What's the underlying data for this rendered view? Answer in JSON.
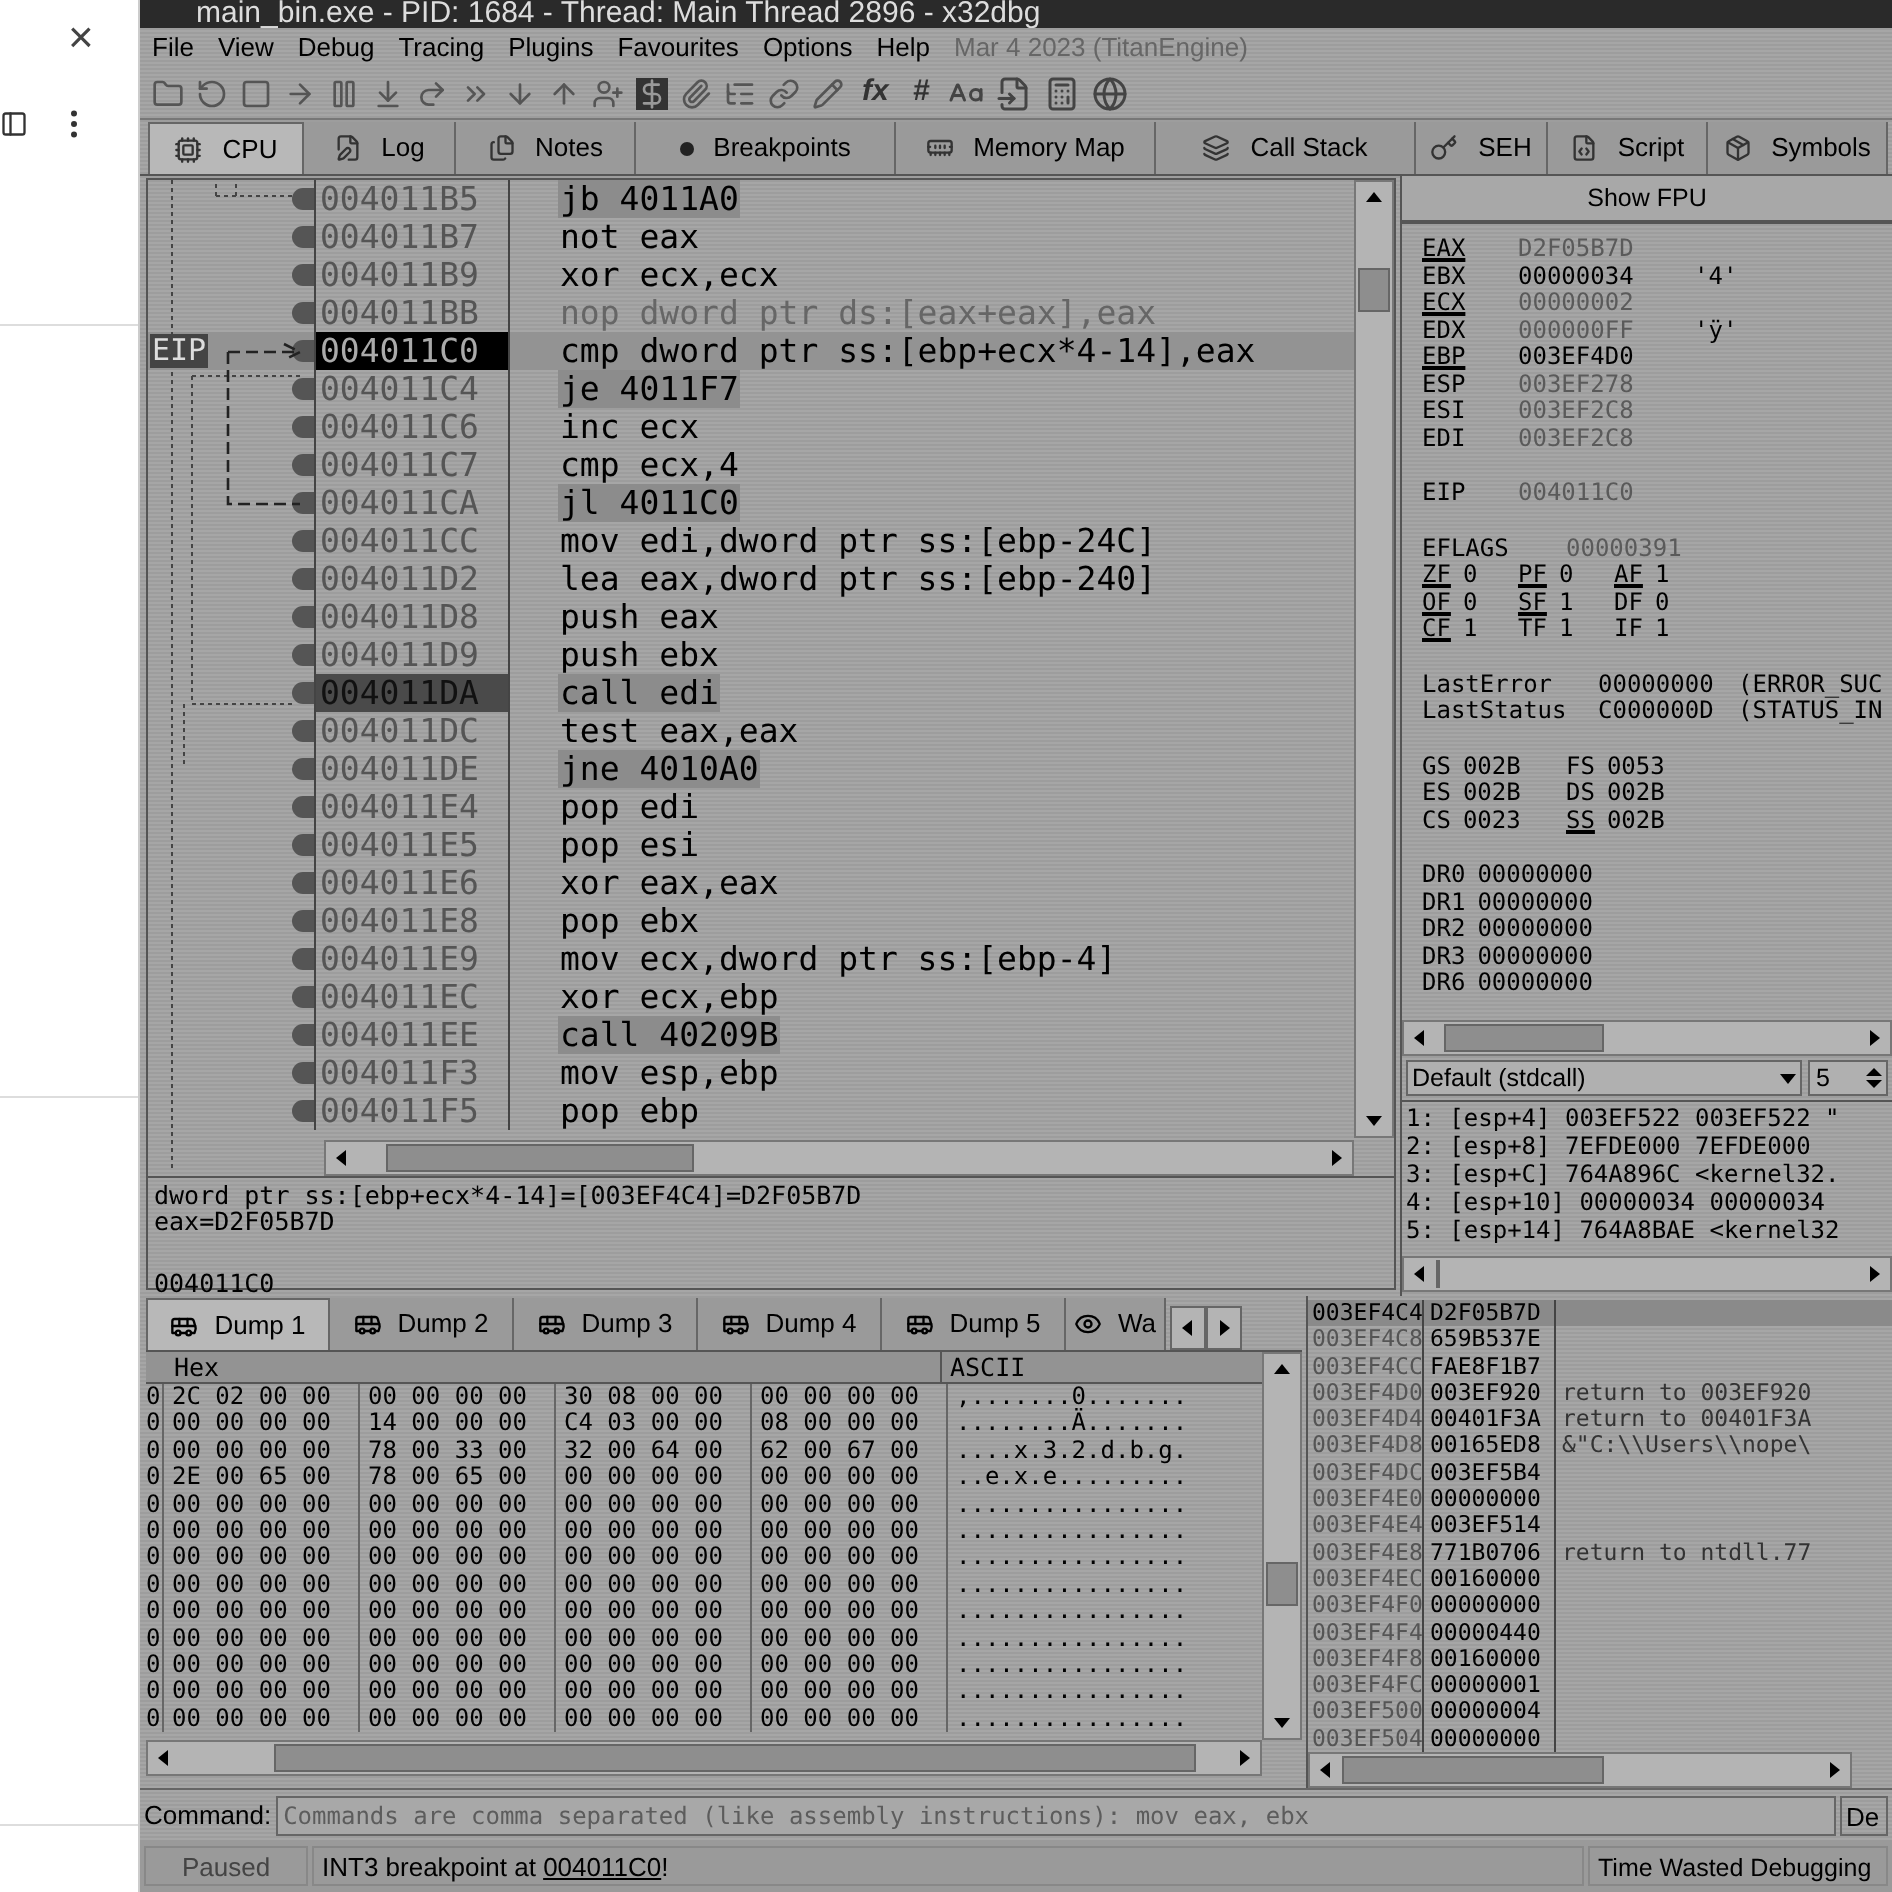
{
  "browser": {
    "close_glyph": "×"
  },
  "window": {
    "title": "main_bin.exe - PID: 1684 - Thread: Main Thread 2896 - x32dbg"
  },
  "menu": [
    "File",
    "View",
    "Debug",
    "Tracing",
    "Plugins",
    "Favourites",
    "Options",
    "Help"
  ],
  "build_info": "Mar 4 2023 (TitanEngine)",
  "toolbar_glyphs": [
    "fx",
    "#"
  ],
  "tabs": [
    {
      "label": "CPU",
      "selected": true
    },
    {
      "label": "Log",
      "selected": false
    },
    {
      "label": "Notes",
      "selected": false
    },
    {
      "label": "Breakpoints",
      "selected": false
    },
    {
      "label": "Memory Map",
      "selected": false
    },
    {
      "label": "Call Stack",
      "selected": false
    },
    {
      "label": "SEH",
      "selected": false
    },
    {
      "label": "Script",
      "selected": false
    },
    {
      "label": "Symbols",
      "selected": false
    }
  ],
  "eip_label": "EIP",
  "disassembly": [
    {
      "address": "004011B5",
      "instruction": "jb 4011A0",
      "kind": "branch",
      "eip": false,
      "selected": false
    },
    {
      "address": "004011B7",
      "instruction": "not eax",
      "kind": "normal",
      "eip": false,
      "selected": false
    },
    {
      "address": "004011B9",
      "instruction": "xor ecx,ecx",
      "kind": "normal",
      "eip": false,
      "selected": false
    },
    {
      "address": "004011BB",
      "instruction": "nop dword ptr ds:[eax+eax],eax",
      "kind": "nop",
      "eip": false,
      "selected": false
    },
    {
      "address": "004011C0",
      "instruction": "cmp dword ptr ss:[ebp+ecx*4-14],eax",
      "kind": "normal",
      "eip": true,
      "selected": false
    },
    {
      "address": "004011C4",
      "instruction": "je 4011F7",
      "kind": "branch",
      "eip": false,
      "selected": false
    },
    {
      "address": "004011C6",
      "instruction": "inc ecx",
      "kind": "normal",
      "eip": false,
      "selected": false
    },
    {
      "address": "004011C7",
      "instruction": "cmp ecx,4",
      "kind": "normal",
      "eip": false,
      "selected": false
    },
    {
      "address": "004011CA",
      "instruction": "jl 4011C0",
      "kind": "branch",
      "eip": false,
      "selected": false
    },
    {
      "address": "004011CC",
      "instruction": "mov edi,dword ptr ss:[ebp-24C]",
      "kind": "normal",
      "eip": false,
      "selected": false
    },
    {
      "address": "004011D2",
      "instruction": "lea eax,dword ptr ss:[ebp-240]",
      "kind": "normal",
      "eip": false,
      "selected": false
    },
    {
      "address": "004011D8",
      "instruction": "push eax",
      "kind": "normal",
      "eip": false,
      "selected": false
    },
    {
      "address": "004011D9",
      "instruction": "push ebx",
      "kind": "normal",
      "eip": false,
      "selected": false
    },
    {
      "address": "004011DA",
      "instruction": "call edi",
      "kind": "call",
      "eip": false,
      "selected": true
    },
    {
      "address": "004011DC",
      "instruction": "test eax,eax",
      "kind": "normal",
      "eip": false,
      "selected": false
    },
    {
      "address": "004011DE",
      "instruction": "jne 4010A0",
      "kind": "branch",
      "eip": false,
      "selected": false
    },
    {
      "address": "004011E4",
      "instruction": "pop edi",
      "kind": "normal",
      "eip": false,
      "selected": false
    },
    {
      "address": "004011E5",
      "instruction": "pop esi",
      "kind": "normal",
      "eip": false,
      "selected": false
    },
    {
      "address": "004011E6",
      "instruction": "xor eax,eax",
      "kind": "normal",
      "eip": false,
      "selected": false
    },
    {
      "address": "004011E8",
      "instruction": "pop ebx",
      "kind": "normal",
      "eip": false,
      "selected": false
    },
    {
      "address": "004011E9",
      "instruction": "mov ecx,dword ptr ss:[ebp-4]",
      "kind": "normal",
      "eip": false,
      "selected": false
    },
    {
      "address": "004011EC",
      "instruction": "xor ecx,ebp",
      "kind": "normal",
      "eip": false,
      "selected": false
    },
    {
      "address": "004011EE",
      "instruction": "call 40209B",
      "kind": "call",
      "eip": false,
      "selected": false
    },
    {
      "address": "004011F3",
      "instruction": "mov esp,ebp",
      "kind": "normal",
      "eip": false,
      "selected": false
    },
    {
      "address": "004011F5",
      "instruction": "pop ebp",
      "kind": "normal",
      "eip": false,
      "selected": false
    }
  ],
  "info_lines": [
    "dword ptr ss:[ebp+ecx*4-14]=[003EF4C4]=D2F05B7D",
    "eax=D2F05B7D"
  ],
  "info_address": "004011C0",
  "fpu_button": "Show FPU",
  "registers": [
    {
      "name": "EAX",
      "value": "D2F05B7D",
      "underlined": true,
      "changed": false
    },
    {
      "name": "EBX",
      "value": "00000034",
      "comment": "'4'",
      "underlined": false,
      "changed": true
    },
    {
      "name": "ECX",
      "value": "00000002",
      "underlined": true,
      "changed": false
    },
    {
      "name": "EDX",
      "value": "000000FF",
      "comment": "'ÿ'",
      "underlined": false,
      "changed": false
    },
    {
      "name": "EBP",
      "value": "003EF4D0",
      "underlined": true,
      "changed": true
    },
    {
      "name": "ESP",
      "value": "003EF278",
      "underlined": false,
      "changed": false
    },
    {
      "name": "ESI",
      "value": "003EF2C8",
      "underlined": false,
      "changed": false
    },
    {
      "name": "EDI",
      "value": "003EF2C8",
      "underlined": false,
      "changed": false
    }
  ],
  "eip_register": {
    "name": "EIP",
    "value": "004011C0"
  },
  "eflags": {
    "name": "EFLAGS",
    "value": "00000391"
  },
  "flags": [
    [
      {
        "name": "ZF",
        "value": "0",
        "underlined": true
      },
      {
        "name": "PF",
        "value": "0",
        "underlined": true
      },
      {
        "name": "AF",
        "value": "1",
        "underlined": true
      }
    ],
    [
      {
        "name": "OF",
        "value": "0",
        "underlined": true
      },
      {
        "name": "SF",
        "value": "1",
        "underlined": true
      },
      {
        "name": "DF",
        "value": "0",
        "underlined": false
      }
    ],
    [
      {
        "name": "CF",
        "value": "1",
        "underlined": true
      },
      {
        "name": "TF",
        "value": "1",
        "underlined": false
      },
      {
        "name": "IF",
        "value": "1",
        "underlined": false
      }
    ]
  ],
  "last_status": [
    {
      "name": "LastError",
      "value": "00000000",
      "description": "(ERROR_SUC"
    },
    {
      "name": "LastStatus",
      "value": "C000000D",
      "description": "(STATUS_IN"
    }
  ],
  "segments": [
    [
      {
        "name": "GS",
        "value": "002B",
        "underlined": false
      },
      {
        "name": "FS",
        "value": "0053",
        "underlined": false
      }
    ],
    [
      {
        "name": "ES",
        "value": "002B",
        "underlined": false
      },
      {
        "name": "DS",
        "value": "002B",
        "underlined": false
      }
    ],
    [
      {
        "name": "CS",
        "value": "0023",
        "underlined": false
      },
      {
        "name": "SS",
        "value": "002B",
        "underlined": true
      }
    ]
  ],
  "debug_registers": [
    {
      "name": "DR0",
      "value": "00000000"
    },
    {
      "name": "DR1",
      "value": "00000000"
    },
    {
      "name": "DR2",
      "value": "00000000"
    },
    {
      "name": "DR3",
      "value": "00000000"
    },
    {
      "name": "DR6",
      "value": "00000000"
    }
  ],
  "call_convention": "Default (stdcall)",
  "arg_count": "5",
  "stack_args": [
    "1: [esp+4] 003EF522 003EF522 \"",
    "2: [esp+8] 7EFDE000 7EFDE000",
    "3: [esp+C] 764A896C <kernel32.",
    "4: [esp+10] 00000034 00000034",
    "5: [esp+14] 764A8BAE <kernel32"
  ],
  "dump_tabs": [
    {
      "label": "Dump 1",
      "selected": true,
      "kind": "dump"
    },
    {
      "label": "Dump 2",
      "selected": false,
      "kind": "dump"
    },
    {
      "label": "Dump 3",
      "selected": false,
      "kind": "dump"
    },
    {
      "label": "Dump 4",
      "selected": false,
      "kind": "dump"
    },
    {
      "label": "Dump 5",
      "selected": false,
      "kind": "dump"
    },
    {
      "label": "Wa",
      "selected": false,
      "kind": "watch"
    }
  ],
  "dump_columns": [
    "Hex",
    "ASCII"
  ],
  "dump_rows": [
    {
      "address": "0",
      "hex": [
        "2C 02 00 00",
        "00 00 00 00",
        "30 08 00 00",
        "00 00 00 00"
      ],
      "ascii": ",.......0......."
    },
    {
      "address": "0",
      "hex": [
        "00 00 00 00",
        "14 00 00 00",
        "C4 03 00 00",
        "08 00 00 00"
      ],
      "ascii": "........Ä......."
    },
    {
      "address": "0",
      "hex": [
        "00 00 00 00",
        "78 00 33 00",
        "32 00 64 00",
        "62 00 67 00"
      ],
      "ascii": "....x.3.2.d.b.g."
    },
    {
      "address": "0",
      "hex": [
        "2E 00 65 00",
        "78 00 65 00",
        "00 00 00 00",
        "00 00 00 00"
      ],
      "ascii": "..e.x.e........."
    },
    {
      "address": "0",
      "hex": [
        "00 00 00 00",
        "00 00 00 00",
        "00 00 00 00",
        "00 00 00 00"
      ],
      "ascii": "................"
    },
    {
      "address": "0",
      "hex": [
        "00 00 00 00",
        "00 00 00 00",
        "00 00 00 00",
        "00 00 00 00"
      ],
      "ascii": "................"
    },
    {
      "address": "0",
      "hex": [
        "00 00 00 00",
        "00 00 00 00",
        "00 00 00 00",
        "00 00 00 00"
      ],
      "ascii": "................"
    },
    {
      "address": "0",
      "hex": [
        "00 00 00 00",
        "00 00 00 00",
        "00 00 00 00",
        "00 00 00 00"
      ],
      "ascii": "................"
    },
    {
      "address": "0",
      "hex": [
        "00 00 00 00",
        "00 00 00 00",
        "00 00 00 00",
        "00 00 00 00"
      ],
      "ascii": "................"
    },
    {
      "address": "0",
      "hex": [
        "00 00 00 00",
        "00 00 00 00",
        "00 00 00 00",
        "00 00 00 00"
      ],
      "ascii": "................"
    },
    {
      "address": "0",
      "hex": [
        "00 00 00 00",
        "00 00 00 00",
        "00 00 00 00",
        "00 00 00 00"
      ],
      "ascii": "................"
    },
    {
      "address": "0",
      "hex": [
        "00 00 00 00",
        "00 00 00 00",
        "00 00 00 00",
        "00 00 00 00"
      ],
      "ascii": "................"
    },
    {
      "address": "0",
      "hex": [
        "00 00 00 00",
        "00 00 00 00",
        "00 00 00 00",
        "00 00 00 00"
      ],
      "ascii": "................"
    }
  ],
  "stack": [
    {
      "address": "003EF4C4",
      "value": "D2F05B7D",
      "selected": true
    },
    {
      "address": "003EF4C8",
      "value": "659B537E",
      "selected": false
    },
    {
      "address": "003EF4CC",
      "value": "FAE8F1B7",
      "selected": false
    },
    {
      "address": "003EF4D0",
      "value": "003EF920",
      "comment": "return to 003EF920",
      "selected": false
    },
    {
      "address": "003EF4D4",
      "value": "00401F3A",
      "comment": "return to 00401F3A",
      "selected": false
    },
    {
      "address": "003EF4D8",
      "value": "00165ED8",
      "comment": "&\"C:\\\\Users\\\\nope\\",
      "selected": false
    },
    {
      "address": "003EF4DC",
      "value": "003EF5B4",
      "selected": false
    },
    {
      "address": "003EF4E0",
      "value": "00000000",
      "selected": false
    },
    {
      "address": "003EF4E4",
      "value": "003EF514",
      "selected": false
    },
    {
      "address": "003EF4E8",
      "value": "771B0706",
      "comment": "return to ntdll.77",
      "selected": false
    },
    {
      "address": "003EF4EC",
      "value": "00160000",
      "selected": false
    },
    {
      "address": "003EF4F0",
      "value": "00000000",
      "selected": false
    },
    {
      "address": "003EF4F4",
      "value": "00000440",
      "selected": false
    },
    {
      "address": "003EF4F8",
      "value": "00160000",
      "selected": false
    },
    {
      "address": "003EF4FC",
      "value": "00000001",
      "selected": false
    },
    {
      "address": "003EF500",
      "value": "00000004",
      "selected": false
    },
    {
      "address": "003EF504",
      "value": "00000000",
      "selected": false
    }
  ],
  "command": {
    "label": "Command:",
    "placeholder": "Commands are comma separated (like assembly instructions): mov eax, ebx",
    "dropdown": "De"
  },
  "status_bar": {
    "state": "Paused",
    "message_prefix": "INT3 breakpoint at ",
    "message_link": "004011C0",
    "message_suffix": "!",
    "right": "Time Wasted Debugging"
  }
}
